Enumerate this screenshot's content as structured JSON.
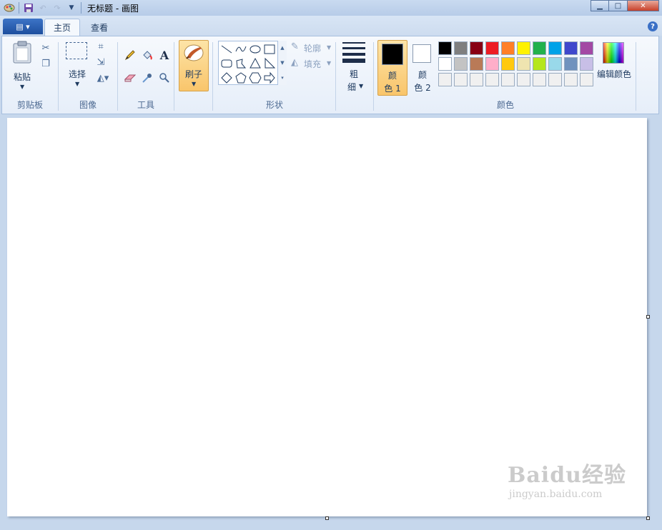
{
  "window": {
    "title": "无标题 - 画图"
  },
  "tabs": {
    "home": "主页",
    "view": "查看"
  },
  "help": "?",
  "clipboard": {
    "paste": "粘贴",
    "group": "剪贴板"
  },
  "image": {
    "select": "选择",
    "group": "图像"
  },
  "tools": {
    "group": "工具"
  },
  "brushes": {
    "label": "刷子"
  },
  "shapes": {
    "outline": "轮廓",
    "fill": "填充",
    "group": "形状"
  },
  "size": {
    "label_top": "粗",
    "label_bottom": "细"
  },
  "colors": {
    "color1_top": "颜",
    "color1_bottom": "色 1",
    "color2_top": "颜",
    "color2_bottom": "色 2",
    "edit": "编辑颜色",
    "group": "颜色",
    "color1_value": "#000000",
    "color2_value": "#ffffff",
    "palette_row1": [
      "#000000",
      "#7f7f7f",
      "#880015",
      "#ed1c24",
      "#ff7f27",
      "#fff200",
      "#22b14c",
      "#00a2e8",
      "#3f48cc",
      "#a349a4"
    ],
    "palette_row2": [
      "#ffffff",
      "#c3c3c3",
      "#b97a57",
      "#ffaec9",
      "#ffc90e",
      "#efe4b0",
      "#b5e61d",
      "#99d9ea",
      "#7092be",
      "#c8bfe7"
    ],
    "palette_row3": [
      "#f0f0f0",
      "#f0f0f0",
      "#f0f0f0",
      "#f0f0f0",
      "#f0f0f0",
      "#f0f0f0",
      "#f0f0f0",
      "#f0f0f0",
      "#f0f0f0",
      "#f0f0f0"
    ]
  },
  "watermark": {
    "main": "Baidu经验",
    "sub": "jingyan.baidu.com"
  }
}
